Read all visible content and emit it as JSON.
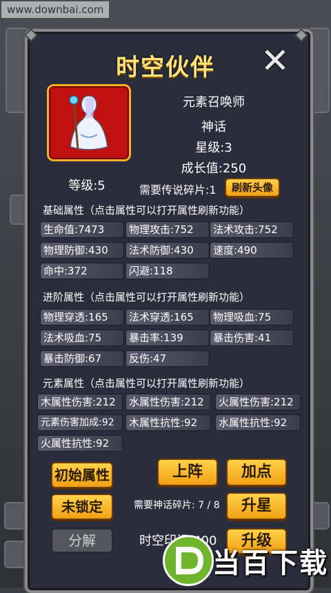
{
  "watermark_top": "www.downbai.com",
  "title": "时空伙伴",
  "hero": {
    "class": "元素召唤师",
    "rarity": "神话",
    "stars": "星级:3",
    "growth": "成长值:250",
    "level": "等级:5",
    "fragments_needed": "需要传说碎片:1",
    "refresh_avatar": "刷新头像"
  },
  "basic": {
    "title": "基础属性（点击属性可以打开属性刷新功能）",
    "items": [
      "生命值:7473",
      "物理攻击:752",
      "法术攻击:752",
      "物理防御:430",
      "法术防御:430",
      "速度:490",
      "命中:372",
      "闪避:118"
    ]
  },
  "advanced": {
    "title": "进阶属性（点击属性可以打开属性刷新功能）",
    "items": [
      "物理穿透:165",
      "法术穿透:165",
      "物理吸血:75",
      "法术吸血:75",
      "暴击率:139",
      "暴击伤害:41",
      "暴击防御:67",
      "反伤:47"
    ]
  },
  "element": {
    "title": "元素属性（点击属性可以打开属性刷新功能）",
    "items": [
      "木属性伤害:212",
      "水属性伤害:212",
      "火属性伤害:212",
      "元素伤害加成:92",
      "木属性抗性:92",
      "水属性抗性:92",
      "火属性抗性:92"
    ]
  },
  "buttons": {
    "initial_attr": "初始属性",
    "unlocked": "未锁定",
    "decompose": "分解",
    "deploy": "上阵",
    "add_points": "加点",
    "star_up": "升星",
    "upgrade": "升级"
  },
  "myth_fragments": "需要神话碎片: 7 / 8",
  "seal": "时空印记:400",
  "logo_text": "当百下载",
  "colors": {
    "gold": "#ffd24a",
    "panel": "#2b2d3d",
    "portrait": "#c01010"
  }
}
